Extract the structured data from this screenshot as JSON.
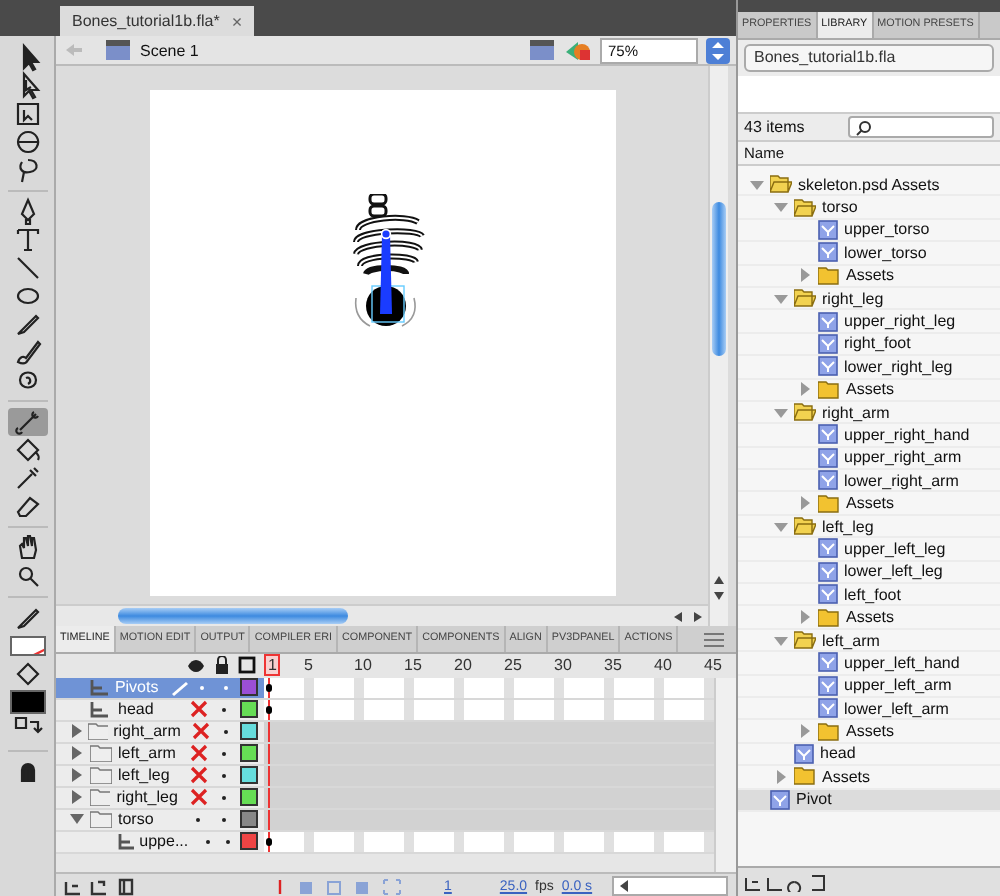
{
  "document_tab": {
    "title": "Bones_tutorial1b.fla*",
    "close": "×"
  },
  "edit_bar": {
    "scene": "Scene 1",
    "zoom": "75%"
  },
  "tools": [
    {
      "kind": "selection",
      "selected": false
    },
    {
      "kind": "subselection",
      "selected": false
    },
    {
      "kind": "transform",
      "selected": false
    },
    {
      "kind": "rotate3d",
      "selected": false
    },
    {
      "kind": "lasso",
      "selected": false
    },
    {
      "kind": "pen",
      "selected": false
    },
    {
      "kind": "text",
      "selected": false
    },
    {
      "kind": "line",
      "selected": false
    },
    {
      "kind": "oval",
      "selected": false
    },
    {
      "kind": "pencil",
      "selected": false
    },
    {
      "kind": "brush",
      "selected": false
    },
    {
      "kind": "deco",
      "selected": false
    },
    {
      "kind": "bone",
      "selected": true
    },
    {
      "kind": "bucket",
      "selected": false
    },
    {
      "kind": "eyedropper",
      "selected": false
    },
    {
      "kind": "eraser",
      "selected": false
    },
    {
      "kind": "hand",
      "selected": false
    },
    {
      "kind": "zoom",
      "selected": false
    },
    {
      "kind": "stroke",
      "selected": false
    },
    {
      "kind": "nostroke",
      "selected": false
    },
    {
      "kind": "fillbucket",
      "selected": false
    },
    {
      "kind": "fill",
      "selected": false
    },
    {
      "kind": "swap",
      "selected": false
    },
    {
      "kind": "snap",
      "selected": false
    }
  ],
  "timeline": {
    "tabs": [
      {
        "label": "TIMELINE",
        "selected": true
      },
      {
        "label": "MOTION EDIT",
        "selected": false
      },
      {
        "label": "OUTPUT",
        "selected": false
      },
      {
        "label": "COMPILER ERI",
        "selected": false
      },
      {
        "label": "COMPONENT",
        "selected": false
      },
      {
        "label": "COMPONENTS",
        "selected": false
      },
      {
        "label": "ALIGN",
        "selected": false
      },
      {
        "label": "PV3DPANEL",
        "selected": false
      },
      {
        "label": "ACTIONS",
        "selected": false
      }
    ],
    "frame_numbers": [
      "1",
      "5",
      "10",
      "15",
      "20",
      "25",
      "30",
      "35",
      "40",
      "45"
    ],
    "layers": [
      {
        "name": "Pivots",
        "kind": "layer",
        "selected": true,
        "visible": true,
        "color": "#9b4fd6",
        "keyframe": true
      },
      {
        "name": "head",
        "kind": "layer",
        "selected": false,
        "visible": false,
        "color": "#66dd55",
        "keyframe": true
      },
      {
        "name": "right_arm",
        "kind": "folder",
        "expanded": false,
        "selected": false,
        "visible": false,
        "color": "#66dddd",
        "keyframe": false
      },
      {
        "name": "left_arm",
        "kind": "folder",
        "expanded": false,
        "selected": false,
        "visible": false,
        "color": "#66dd55",
        "keyframe": false
      },
      {
        "name": "left_leg",
        "kind": "folder",
        "expanded": false,
        "selected": false,
        "visible": false,
        "color": "#66dddd",
        "keyframe": false
      },
      {
        "name": "right_leg",
        "kind": "folder",
        "expanded": false,
        "selected": false,
        "visible": false,
        "color": "#66dd55",
        "keyframe": false
      },
      {
        "name": "torso",
        "kind": "folder",
        "expanded": true,
        "selected": false,
        "visible": true,
        "color": "#888888",
        "keyframe": false,
        "children": [
          {
            "name": "uppe...",
            "kind": "layer",
            "selected": false,
            "visible": true,
            "color": "#ee4444",
            "keyframe": true
          }
        ]
      }
    ],
    "current_frame": "1",
    "fps": "25.0",
    "fps_unit": "fps",
    "elapsed": "0.0 s"
  },
  "library": {
    "tabs": [
      {
        "label": "PROPERTIES",
        "selected": false
      },
      {
        "label": "LIBRARY",
        "selected": true
      },
      {
        "label": "MOTION PRESETS",
        "selected": false
      }
    ],
    "document": "Bones_tutorial1b.fla",
    "count": "43 items",
    "column": "Name",
    "items": [
      {
        "name": "skeleton.psd Assets",
        "kind": "folder",
        "expanded": true,
        "selected": false,
        "children": [
          {
            "name": "torso",
            "kind": "folder",
            "expanded": true,
            "selected": false,
            "children": [
              {
                "name": "upper_torso",
                "kind": "symbol",
                "selected": false
              },
              {
                "name": "lower_torso",
                "kind": "symbol",
                "selected": false
              },
              {
                "name": "Assets",
                "kind": "folder",
                "expanded": false,
                "selected": false
              }
            ]
          },
          {
            "name": "right_leg",
            "kind": "folder",
            "expanded": true,
            "selected": false,
            "children": [
              {
                "name": "upper_right_leg",
                "kind": "symbol",
                "selected": false
              },
              {
                "name": "right_foot",
                "kind": "symbol",
                "selected": false
              },
              {
                "name": "lower_right_leg",
                "kind": "symbol",
                "selected": false
              },
              {
                "name": "Assets",
                "kind": "folder",
                "expanded": false,
                "selected": false
              }
            ]
          },
          {
            "name": "right_arm",
            "kind": "folder",
            "expanded": true,
            "selected": false,
            "children": [
              {
                "name": "upper_right_hand",
                "kind": "symbol",
                "selected": false
              },
              {
                "name": "upper_right_arm",
                "kind": "symbol",
                "selected": false
              },
              {
                "name": "lower_right_arm",
                "kind": "symbol",
                "selected": false
              },
              {
                "name": "Assets",
                "kind": "folder",
                "expanded": false,
                "selected": false
              }
            ]
          },
          {
            "name": "left_leg",
            "kind": "folder",
            "expanded": true,
            "selected": false,
            "children": [
              {
                "name": "upper_left_leg",
                "kind": "symbol",
                "selected": false
              },
              {
                "name": "lower_left_leg",
                "kind": "symbol",
                "selected": false
              },
              {
                "name": "left_foot",
                "kind": "symbol",
                "selected": false
              },
              {
                "name": "Assets",
                "kind": "folder",
                "expanded": false,
                "selected": false
              }
            ]
          },
          {
            "name": "left_arm",
            "kind": "folder",
            "expanded": true,
            "selected": false,
            "children": [
              {
                "name": "upper_left_hand",
                "kind": "symbol",
                "selected": false
              },
              {
                "name": "upper_left_arm",
                "kind": "symbol",
                "selected": false
              },
              {
                "name": "lower_left_arm",
                "kind": "symbol",
                "selected": false
              },
              {
                "name": "Assets",
                "kind": "folder",
                "expanded": false,
                "selected": false
              }
            ]
          },
          {
            "name": "head",
            "kind": "symbol",
            "selected": false
          },
          {
            "name": "Assets",
            "kind": "folder",
            "expanded": false,
            "selected": false
          }
        ]
      },
      {
        "name": "Pivot",
        "kind": "symbol",
        "selected": true
      }
    ]
  }
}
